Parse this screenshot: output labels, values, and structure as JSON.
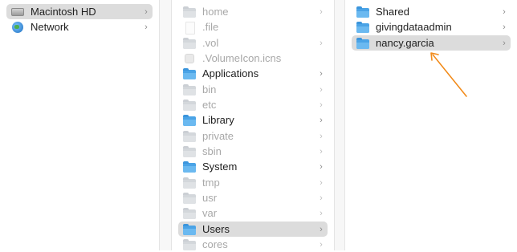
{
  "column1": {
    "items": [
      {
        "label": "Macintosh HD",
        "icon": "hard-drive-icon",
        "selected": true
      },
      {
        "label": "Network",
        "icon": "network-globe-icon",
        "selected": false
      }
    ]
  },
  "column2": {
    "items": [
      {
        "label": "home",
        "icon": "folder-icon",
        "dim": true
      },
      {
        "label": ".file",
        "icon": "file-icon",
        "dim": true
      },
      {
        "label": ".vol",
        "icon": "folder-icon",
        "dim": true
      },
      {
        "label": ".VolumeIcon.icns",
        "icon": "icns-file-icon",
        "dim": true
      },
      {
        "label": "Applications",
        "icon": "applications-folder-icon",
        "dim": false
      },
      {
        "label": "bin",
        "icon": "folder-icon",
        "dim": true
      },
      {
        "label": "etc",
        "icon": "folder-icon",
        "dim": true
      },
      {
        "label": "Library",
        "icon": "library-folder-icon",
        "dim": false
      },
      {
        "label": "private",
        "icon": "folder-icon",
        "dim": true
      },
      {
        "label": "sbin",
        "icon": "folder-icon",
        "dim": true
      },
      {
        "label": "System",
        "icon": "system-folder-icon",
        "dim": false
      },
      {
        "label": "tmp",
        "icon": "folder-icon",
        "dim": true
      },
      {
        "label": "usr",
        "icon": "folder-icon",
        "dim": true
      },
      {
        "label": "var",
        "icon": "folder-icon",
        "dim": true
      },
      {
        "label": "Users",
        "icon": "users-folder-icon",
        "dim": false,
        "selected": true
      },
      {
        "label": "cores",
        "icon": "folder-icon",
        "dim": true
      }
    ]
  },
  "column3": {
    "items": [
      {
        "label": "Shared",
        "icon": "folder-icon"
      },
      {
        "label": "givingdataadmin",
        "icon": "folder-icon"
      },
      {
        "label": "nancy.garcia",
        "icon": "home-folder-icon",
        "selected": true
      }
    ]
  },
  "colors": {
    "selection": "#dcdcdc",
    "folder_blue": "#4aa3e6",
    "arrow": "#f28c1c"
  },
  "chevron": "›"
}
